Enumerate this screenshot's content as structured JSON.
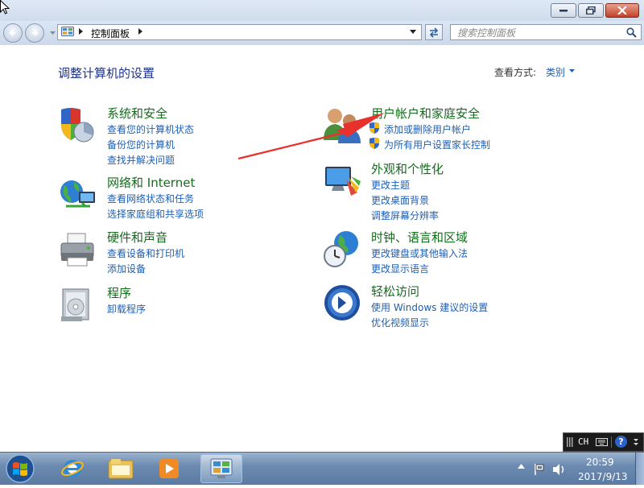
{
  "window": {
    "minimize_label": "minimize",
    "maximize_label": "restore",
    "close_label": "close"
  },
  "address_bar": {
    "crumb": "控制面板",
    "search_placeholder": "搜索控制面板"
  },
  "main": {
    "heading": "调整计算机的设置",
    "view_by_label": "查看方式:",
    "view_by_value": "类别"
  },
  "categories": [
    {
      "title": "系统和安全",
      "links": [
        "查看您的计算机状态",
        "备份您的计算机",
        "查找并解决问题"
      ],
      "icon": "shield-computer-icon"
    },
    {
      "title": "网络和 Internet",
      "links": [
        "查看网络状态和任务",
        "选择家庭组和共享选项"
      ],
      "icon": "network-globe-icon"
    },
    {
      "title": "硬件和声音",
      "links": [
        "查看设备和打印机",
        "添加设备"
      ],
      "icon": "printer-icon"
    },
    {
      "title": "程序",
      "links": [
        "卸载程序"
      ],
      "icon": "programs-icon"
    },
    {
      "title": "用户帐户和家庭安全",
      "links": [
        "添加或删除用户帐户",
        "为所有用户设置家长控制"
      ],
      "icon": "users-icon"
    },
    {
      "title": "外观和个性化",
      "links": [
        "更改主题",
        "更改桌面背景",
        "调整屏幕分辨率"
      ],
      "icon": "monitor-palette-icon"
    },
    {
      "title": "时钟、语言和区域",
      "links": [
        "更改键盘或其他输入法",
        "更改显示语言"
      ],
      "icon": "clock-globe-icon"
    },
    {
      "title": "轻松访问",
      "links": [
        "使用 Windows 建议的设置",
        "优化视频显示"
      ],
      "icon": "ease-of-access-icon"
    }
  ],
  "language_bar": {
    "lang": "CH",
    "help": "?"
  },
  "taskbar": {
    "time": "20:59",
    "date": "2017/9/13"
  },
  "colors": {
    "category_title": "#136c1b",
    "link": "#1e5fb3",
    "heading": "#1e3287",
    "annotation_arrow": "#e8302c"
  }
}
